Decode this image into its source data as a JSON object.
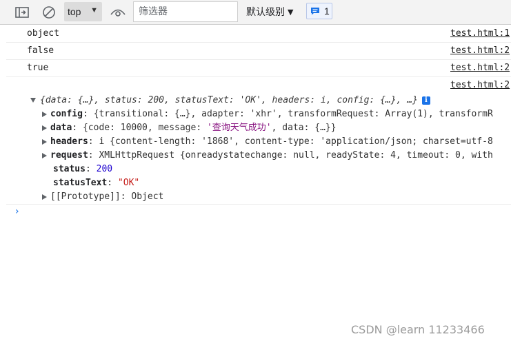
{
  "toolbar": {
    "dock_icon": "panel-toggle-icon",
    "clear_icon": "clear-console-icon",
    "context": "top",
    "eye_icon": "live-expression-icon",
    "filter_placeholder": "筛选器",
    "levels": "默认级别",
    "issues_count": "1",
    "issues_icon": "message-icon"
  },
  "console": {
    "rows": [
      {
        "message": "object",
        "source": "test.html:1"
      },
      {
        "message": "false",
        "source": "test.html:2"
      },
      {
        "message": "true",
        "source": "test.html:2"
      },
      {
        "message": "",
        "source": "test.html:2"
      }
    ],
    "object_summary": "{data: {…}, status: 200, statusText: 'OK', headers: i, config: {…}, …}",
    "properties": {
      "config_key": "config",
      "config_val": "{transitional: {…}, adapter: 'xhr', transformRequest: Array(1), transformR",
      "data_key": "data",
      "data_val_pre": "{code: 10000, message: ",
      "data_val_str": "'查询天气成功'",
      "data_val_post": ", data: {…}}",
      "headers_key": "headers",
      "headers_val": "i {content-length: '1868', content-type: 'application/json; charset=utf-8",
      "request_key": "request",
      "request_val": "XMLHttpRequest {onreadystatechange: null, readyState: 4, timeout: 0, with",
      "status_key": "status",
      "status_val": "200",
      "statusText_key": "statusText",
      "statusText_val": "\"OK\"",
      "prototype_key": "[[Prototype]]",
      "prototype_val": "Object"
    },
    "info_badge": "i",
    "prompt_icon": "chevron-right-icon"
  },
  "watermark": "CSDN @learn 11233466",
  "colors": {
    "accent": "#1a73e8",
    "string": "#c41a16",
    "number": "#1c00cf"
  }
}
